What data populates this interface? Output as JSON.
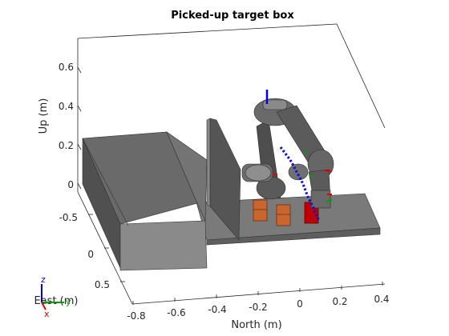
{
  "figure": {
    "title": "Picked-up target box",
    "axes": {
      "x_label": "North (m)",
      "y_label": "East (m)",
      "z_label": "Up (m)",
      "x_ticks": [
        "-0.8",
        "-0.6",
        "-0.4",
        "-0.2",
        "0",
        "0.2",
        "0.4"
      ],
      "y_ticks": [
        "-0.5",
        "0",
        "0.5"
      ],
      "z_ticks": [
        "0",
        "0.2",
        "0.4",
        "0.6"
      ]
    },
    "triad": {
      "x": "x",
      "y": "y",
      "z": "z"
    },
    "colors": {
      "background": "#ffffff",
      "panel": "#f2f2f2",
      "robot": "#5b5b5b",
      "robot_light": "#8a8a8a",
      "structure": "#6e6e6e",
      "box": "#c8662e",
      "target_box": "#c00000",
      "trajectory": "#1010d8",
      "triad_x": "#e00000",
      "triad_y": "#00a000",
      "triad_z": "#0000e0"
    }
  }
}
